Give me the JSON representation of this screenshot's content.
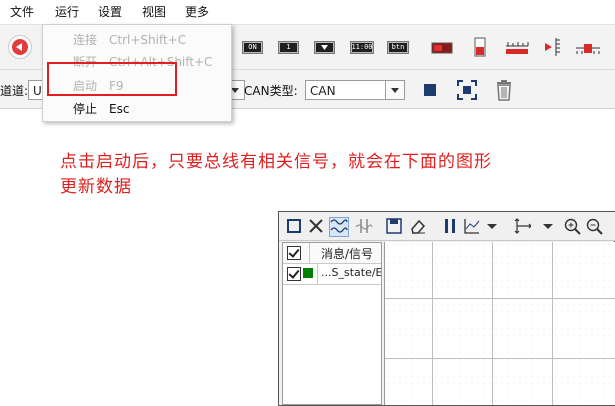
{
  "menubar": {
    "items": [
      "文件",
      "运行",
      "设置",
      "视图",
      "更多"
    ]
  },
  "run_menu": {
    "items": [
      {
        "label": "连接",
        "shortcut": "Ctrl+Shift+C",
        "enabled": false
      },
      {
        "label": "断开",
        "shortcut": "Ctrl+Alt+Shift+C",
        "enabled": false
      },
      {
        "label": "启动",
        "shortcut": "F9",
        "enabled": false
      },
      {
        "label": "停止",
        "shortcut": "Esc",
        "enabled": true
      }
    ]
  },
  "toolbar": {
    "widgets": [
      "ON",
      "1",
      "",
      "11:00",
      "btn"
    ]
  },
  "toolbar2": {
    "channel_label": "道道:",
    "channel_value": "U",
    "can_type_label": "CAN类型:",
    "can_type_value": "CAN"
  },
  "annotation": {
    "line1": "点击启动后，只要总线有相关信号，就会在下面的图形",
    "line2": "更新数据"
  },
  "chart_window": {
    "header": "消息/信号",
    "signal_row": "...S_state/E",
    "signal_color": "#008000"
  },
  "colors": {
    "highlight": "#e02020",
    "annotation": "#e01e1e",
    "toolbar_red": "#d92a2a",
    "icon_blue": "#1c3c6e"
  }
}
